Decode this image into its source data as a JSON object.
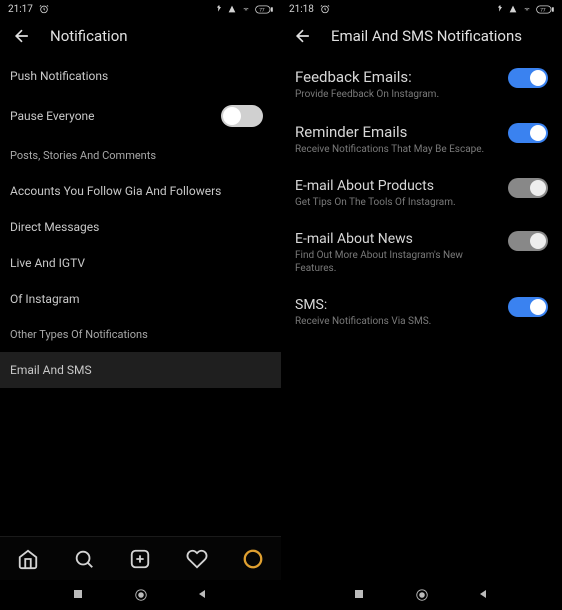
{
  "left": {
    "statusbar": {
      "time": "21:17"
    },
    "header": {
      "title": "Notification"
    },
    "items": {
      "push": "Push Notifications",
      "pause": "Pause Everyone",
      "posts": "Posts, Stories And Comments",
      "accounts": "Accounts You Follow Gia And Followers",
      "dm": "Direct Messages",
      "live": "Live And IGTV",
      "ofig": "Of Instagram",
      "other": "Other Types Of Notifications",
      "email": "Email And SMS"
    }
  },
  "right": {
    "statusbar": {
      "time": "21:18"
    },
    "header": {
      "title": "Email And SMS Notifications"
    },
    "settings": {
      "feedback": {
        "title": "Feedback Emails:",
        "desc": "Provide Feedback On Instagram.",
        "on": true
      },
      "reminder": {
        "title": "Reminder Emails",
        "desc": "Receive Notifications That May Be Escape.",
        "on": true
      },
      "products": {
        "title": "E-mail About Products",
        "desc": "Get Tips On The Tools Of Instagram.",
        "on": false
      },
      "news": {
        "title": "E-mail About News",
        "desc": "Find Out More About Instagram's New Features.",
        "on": false
      },
      "sms": {
        "title": "SMS:",
        "desc": "Receive Notifications Via SMS.",
        "on": true
      }
    }
  }
}
